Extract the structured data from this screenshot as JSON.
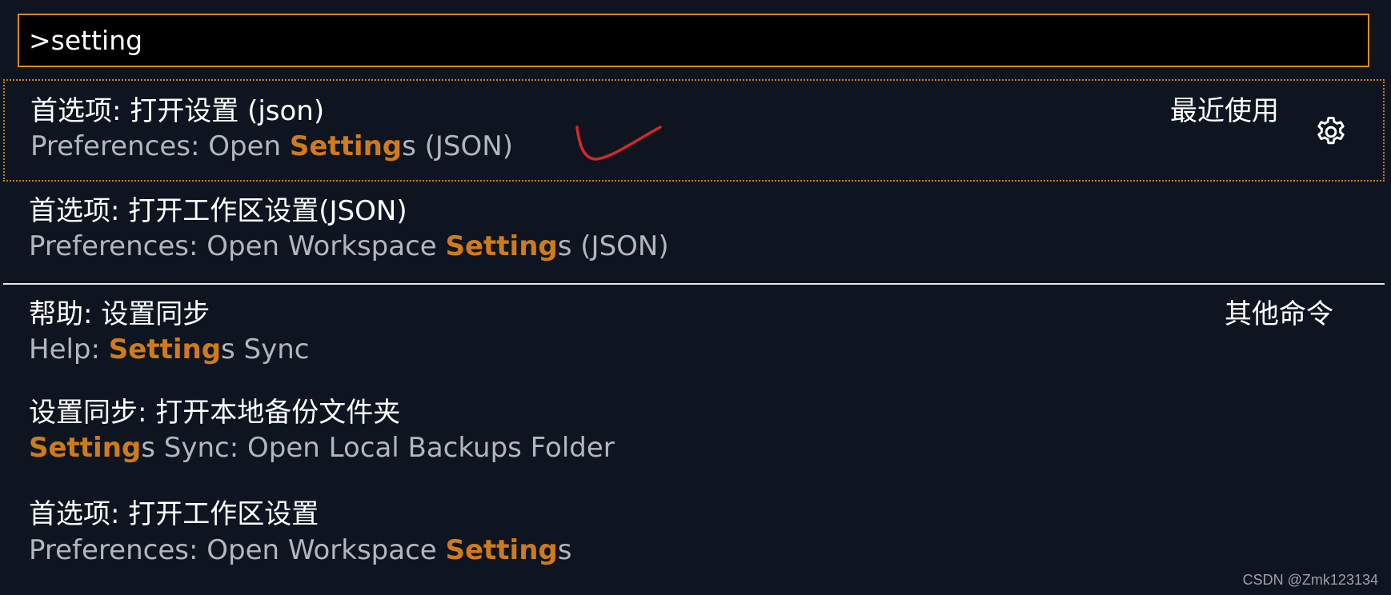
{
  "quick_open": {
    "input_value": ">setting",
    "accent_color": "#e0861b",
    "highlight_color": "#d07b1a"
  },
  "items": [
    {
      "label": "首选项: 打开设置 (json)",
      "detail": {
        "prefix": "Preferences: Open ",
        "match": "Setting",
        "suffix": "s (JSON)"
      },
      "group": "最近使用",
      "focused": true,
      "action_icon": "gear-icon"
    },
    {
      "label": "首选项: 打开工作区设置(JSON)",
      "detail": {
        "prefix": "Preferences: Open Workspace ",
        "match": "Setting",
        "suffix": "s (JSON)"
      }
    },
    {
      "label": "帮助: 设置同步",
      "detail": {
        "prefix": "Help: ",
        "match": "Setting",
        "suffix": "s Sync"
      },
      "group": "其他命令"
    },
    {
      "label": "设置同步: 打开本地备份文件夹",
      "detail": {
        "prefix": "",
        "match": "Setting",
        "suffix": "s Sync: Open Local Backups Folder"
      }
    },
    {
      "label": "首选项: 打开工作区设置",
      "detail": {
        "prefix": "Preferences: Open Workspace ",
        "match": "Setting",
        "suffix": "s"
      }
    }
  ],
  "annotation": {
    "mark": "red-checkmark",
    "color": "#d8262a"
  },
  "watermark": "CSDN @Zmk123134"
}
